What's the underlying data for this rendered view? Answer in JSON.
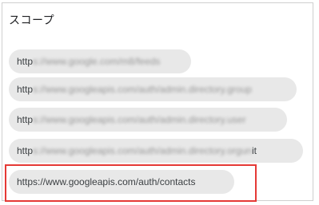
{
  "section": {
    "title": "スコープ"
  },
  "scopes": [
    {
      "prefix": "http",
      "blurred": "s://www.google.com/m8/feeds",
      "suffix": ""
    },
    {
      "prefix": "http",
      "blurred": "s://www.googleapis.com/auth/admin.directory.group",
      "suffix": ""
    },
    {
      "prefix": "http",
      "blurred": "s://www.googleapis.com/auth/admin.directory.user",
      "suffix": ""
    },
    {
      "prefix": "http",
      "blurred": "s://www.googleapis.com/auth/admin.directory.orgun",
      "suffix": "it"
    },
    {
      "prefix": "https://www.googleapis.com/auth/contacts",
      "blurred": "",
      "suffix": ""
    }
  ],
  "highlight_color": "#e53935"
}
